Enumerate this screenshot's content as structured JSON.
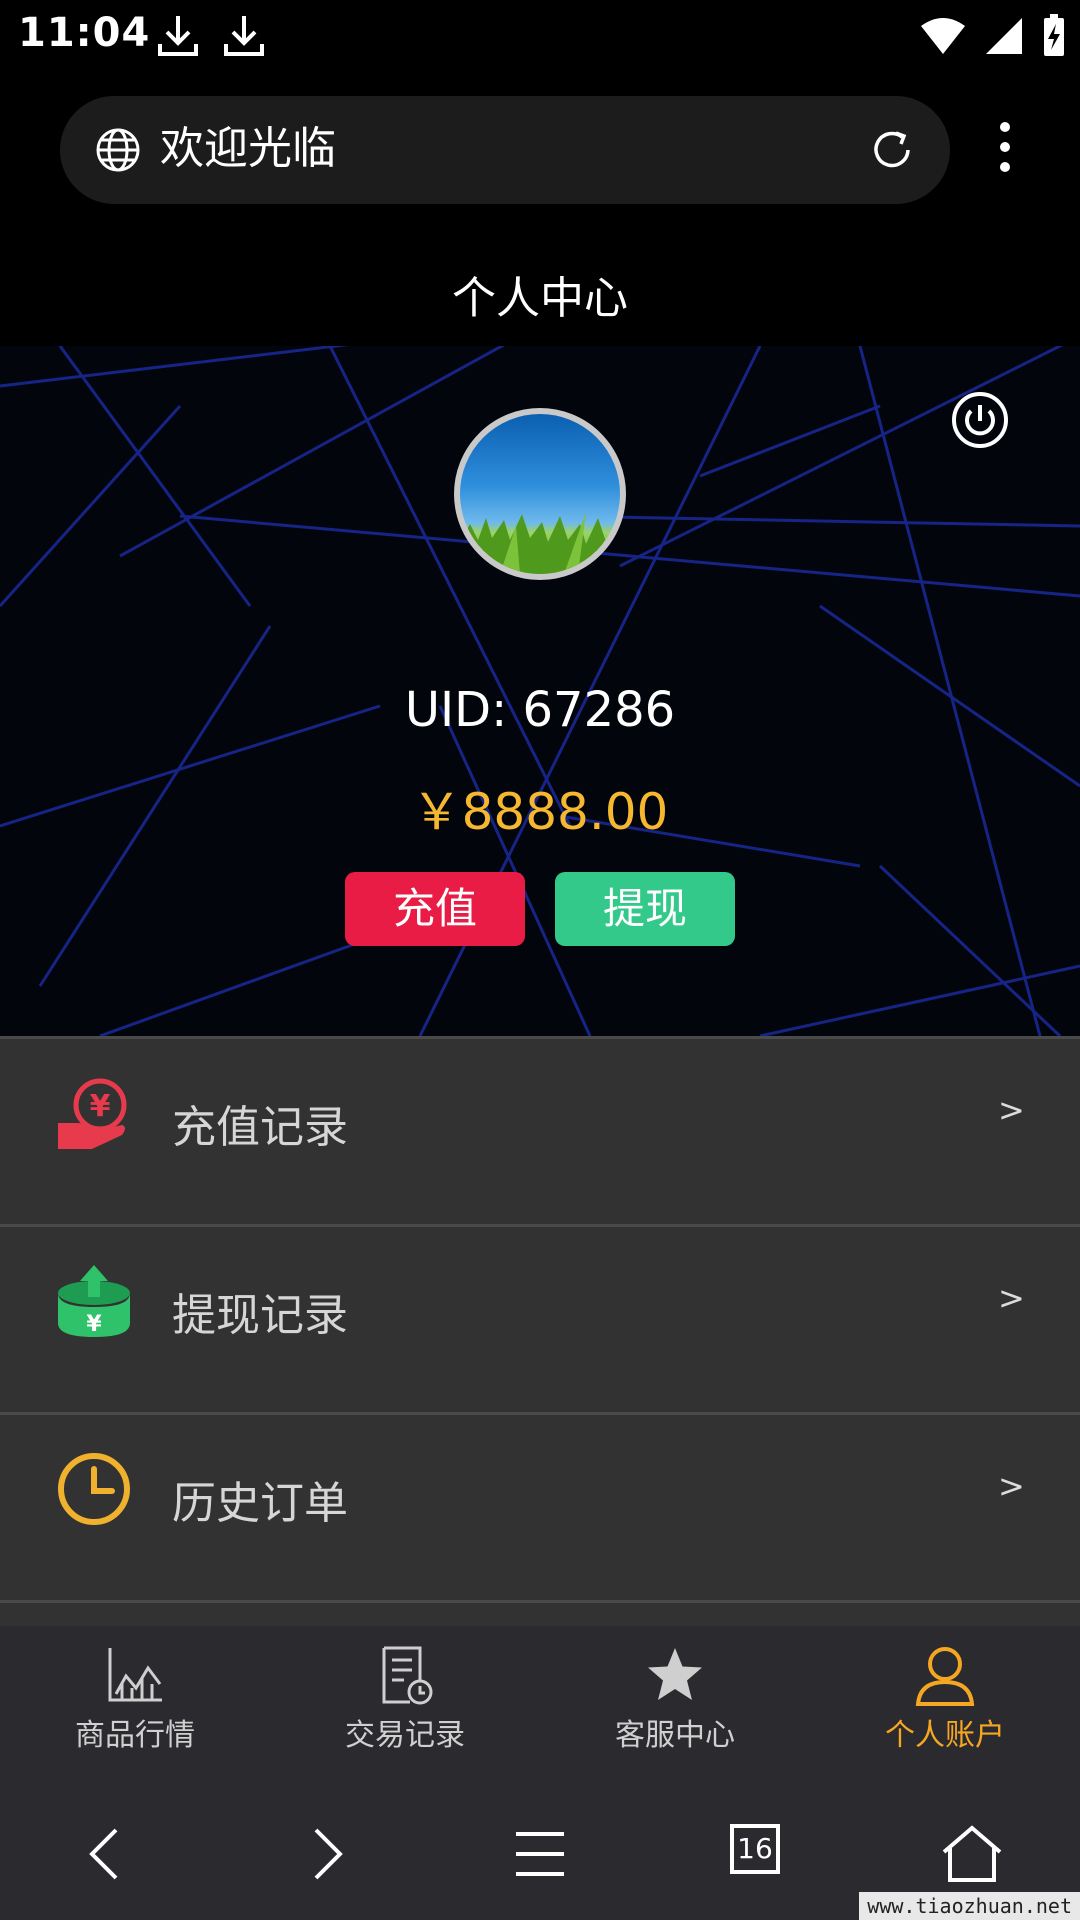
{
  "status": {
    "time": "11:04"
  },
  "browser": {
    "url_text": "欢迎光临",
    "tabs_count": "16"
  },
  "page": {
    "title": "个人中心"
  },
  "profile": {
    "uid_label": "UID:  67286",
    "balance": "￥8888.00",
    "recharge_label": "充值",
    "withdraw_label": "提现"
  },
  "menu": {
    "items": [
      {
        "label": "充值记录",
        "arrow": ">",
        "icon": "recharge-hand-yen-icon"
      },
      {
        "label": "提现记录",
        "arrow": ">",
        "icon": "withdraw-box-arrow-icon"
      },
      {
        "label": "历史订单",
        "arrow": ">",
        "icon": "clock-icon"
      }
    ]
  },
  "tabs": [
    {
      "label": "商品行情",
      "icon": "chart-icon"
    },
    {
      "label": "交易记录",
      "icon": "document-clock-icon"
    },
    {
      "label": "客服中心",
      "icon": "star-icon"
    },
    {
      "label": "个人账户",
      "icon": "person-icon",
      "active": true
    }
  ],
  "watermark": "www.tiaozhuan.net",
  "colors": {
    "accent_gold": "#f5b82e",
    "recharge_red": "#e81c45",
    "withdraw_green": "#33c98a",
    "active_tab": "#f5a623"
  }
}
